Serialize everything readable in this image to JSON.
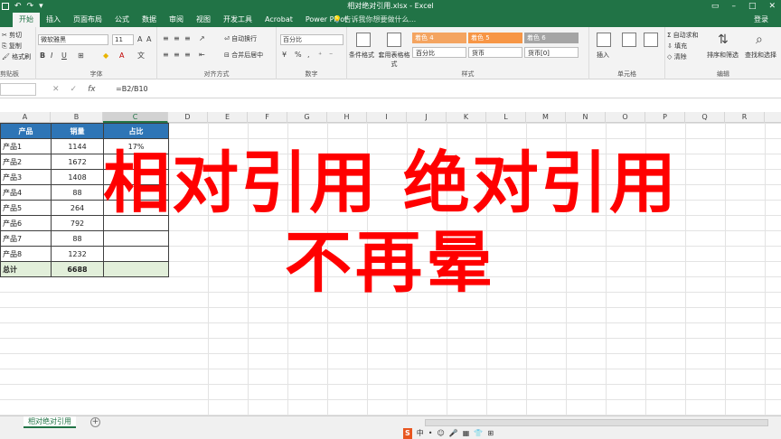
{
  "window": {
    "title": "相对绝对引用.xlsx - Excel",
    "login": "登录"
  },
  "tabs": [
    "开始",
    "插入",
    "页面布局",
    "公式",
    "数据",
    "审阅",
    "视图",
    "开发工具",
    "Acrobat",
    "Power Pivot"
  ],
  "tell_me": "告诉我你想要做什么...",
  "ribbon": {
    "clipboard": {
      "cut": "剪切",
      "copy": "复制",
      "format_painter": "格式刷",
      "label": "剪贴板"
    },
    "font": {
      "name": "微软雅黑",
      "size": "11",
      "label": "字体"
    },
    "alignment": {
      "wrap": "自动换行",
      "merge": "合并后居中",
      "label": "对齐方式"
    },
    "number": {
      "format": "百分比",
      "label": "数字"
    },
    "styles": {
      "conditional": "条件格式",
      "table": "套用表格格式",
      "label": "样式",
      "cells": [
        {
          "text": "着色 4",
          "color": "#f4a460",
          "fg": "#ffffff"
        },
        {
          "text": "着色 5",
          "color": "#f79646",
          "fg": "#ffffff"
        },
        {
          "text": "着色 6",
          "color": "#a5a5a5",
          "fg": "#ffffff"
        },
        {
          "text": "百分比",
          "color": "#ffffff",
          "fg": "#222222"
        },
        {
          "text": "货币",
          "color": "#ffffff",
          "fg": "#222222"
        },
        {
          "text": "货币[0]",
          "color": "#ffffff",
          "fg": "#222222"
        }
      ]
    },
    "cells_group": {
      "insert": "插入",
      "label": "单元格"
    },
    "editing": {
      "autosum": "自动求和",
      "fill": "填充",
      "clear": "清除",
      "sort": "排序和筛选",
      "find": "查找和选择",
      "label": "编辑"
    }
  },
  "formula_bar": {
    "formula": "=B2/B10"
  },
  "columns": [
    "A",
    "B",
    "C",
    "D",
    "E",
    "F",
    "G",
    "H",
    "I",
    "J",
    "K",
    "L",
    "M",
    "N",
    "O",
    "P",
    "Q",
    "R"
  ],
  "selected_column": "C",
  "table": {
    "headers": [
      "产品",
      "销量",
      "占比"
    ],
    "rows": [
      [
        "产品1",
        "1144",
        "17%"
      ],
      [
        "产品2",
        "1672",
        ""
      ],
      [
        "产品3",
        "1408",
        ""
      ],
      [
        "产品4",
        "88",
        ""
      ],
      [
        "产品5",
        "264",
        ""
      ],
      [
        "产品6",
        "792",
        ""
      ],
      [
        "产品7",
        "88",
        ""
      ],
      [
        "产品8",
        "1232",
        ""
      ]
    ],
    "total": [
      "总计",
      "6688",
      ""
    ]
  },
  "overlay": {
    "line1": "相对引用 绝对引用",
    "line2": "不再晕"
  },
  "sheet_tab": "相对绝对引用",
  "ime": [
    "中",
    "•",
    "☺",
    "🎤",
    "▦",
    "👕",
    "⊞"
  ],
  "colors": {
    "excel_green": "#217346",
    "header_blue": "#2e75b6",
    "total_green": "#e2efda",
    "overlay_red": "#ff0000"
  }
}
